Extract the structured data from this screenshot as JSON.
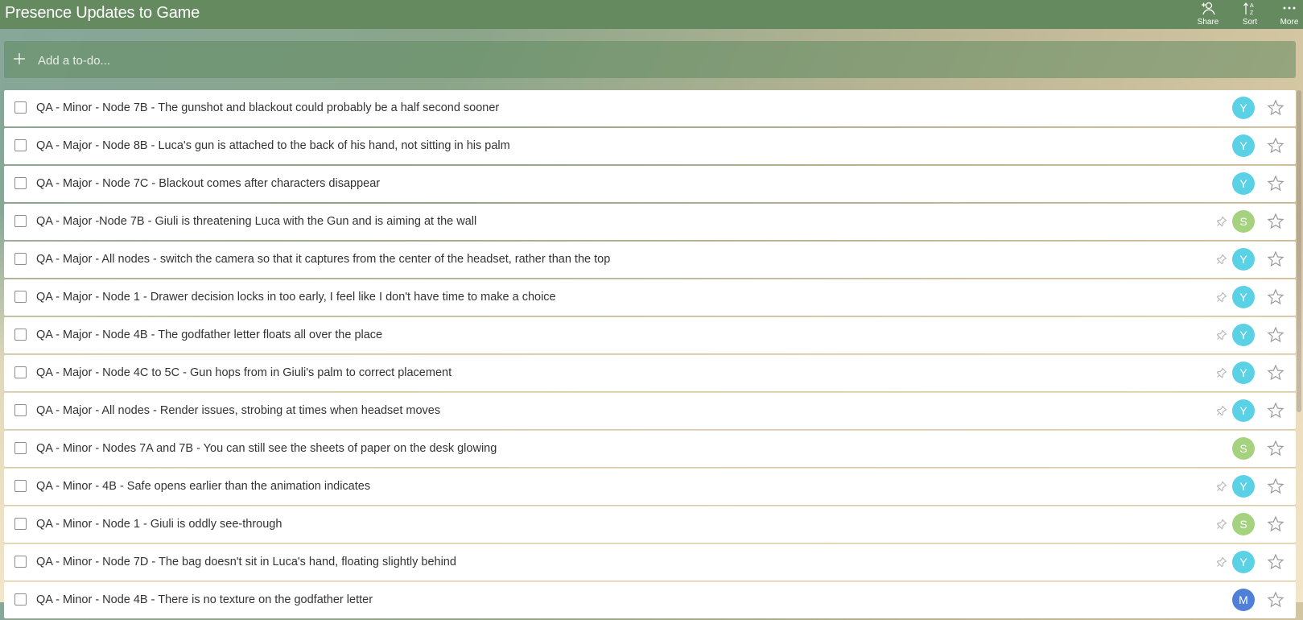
{
  "header": {
    "title": "Presence Updates to Game",
    "share_label": "Share",
    "sort_label": "Sort",
    "more_label": "More"
  },
  "add_todo": {
    "placeholder": "Add a to-do..."
  },
  "colors": {
    "header": "#658a60",
    "avatar_y": "#5bd1e6",
    "avatar_s": "#a5d27f",
    "avatar_m": "#4f7fd6"
  },
  "tasks": [
    {
      "text": "QA - Minor - Node 7B - The gunshot and blackout could probably be a half second sooner",
      "assignee": "Y",
      "pinned": false
    },
    {
      "text": "QA - Major - Node 8B - Luca's gun is attached to the back of his hand, not sitting in his palm",
      "assignee": "Y",
      "pinned": false
    },
    {
      "text": "QA - Major - Node 7C - Blackout comes after characters disappear",
      "assignee": "Y",
      "pinned": false
    },
    {
      "text": "QA - Major -Node 7B - Giuli is threatening Luca with the Gun and is aiming at the wall",
      "assignee": "S",
      "pinned": true
    },
    {
      "text": "QA - Major - All nodes - switch the camera so that it captures from the center of the headset, rather than the top",
      "assignee": "Y",
      "pinned": true
    },
    {
      "text": "QA - Major - Node 1 - Drawer decision locks in too early, I feel like I don't have time to make a choice",
      "assignee": "Y",
      "pinned": true
    },
    {
      "text": "QA - Major - Node 4B - The godfather letter floats all over the place",
      "assignee": "Y",
      "pinned": true
    },
    {
      "text": "QA - Major - Node 4C to 5C - Gun hops from in Giuli's palm to correct placement",
      "assignee": "Y",
      "pinned": true
    },
    {
      "text": "QA - Major - All nodes - Render issues, strobing at times when headset moves",
      "assignee": "Y",
      "pinned": true
    },
    {
      "text": "QA - Minor - Nodes 7A and 7B - You can still see the sheets of paper on the desk glowing",
      "assignee": "S",
      "pinned": false
    },
    {
      "text": "QA - Minor - 4B - Safe opens earlier than the animation indicates",
      "assignee": "Y",
      "pinned": true
    },
    {
      "text": "QA - Minor - Node 1 - Giuli is oddly see-through",
      "assignee": "S",
      "pinned": true
    },
    {
      "text": "QA - Minor - Node 7D - The bag doesn't sit in Luca's hand, floating slightly behind",
      "assignee": "Y",
      "pinned": true
    },
    {
      "text": "QA - Minor - Node 4B - There is no texture on the godfather letter",
      "assignee": "M",
      "pinned": false
    }
  ]
}
